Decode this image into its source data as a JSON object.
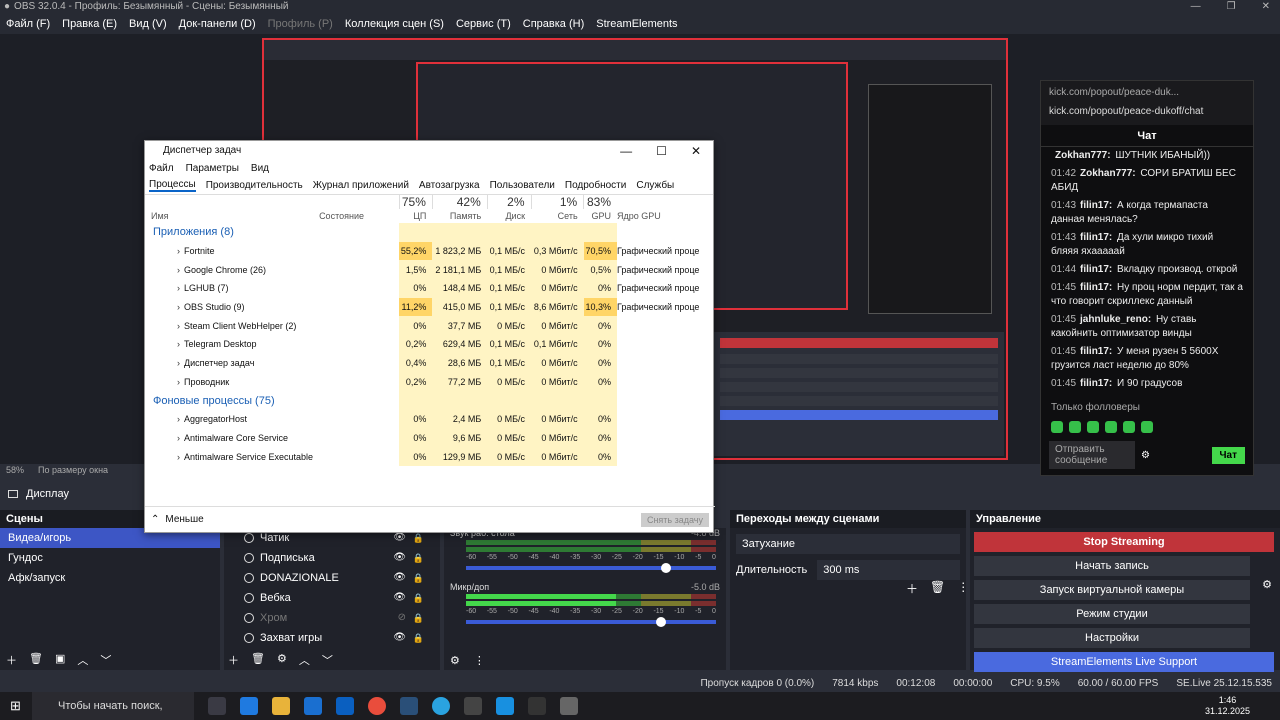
{
  "app": {
    "title": "OBS 32.0.4 - Профиль: Безымянный - Сцены: Безымянный",
    "menu": [
      "Файл (F)",
      "Правка (E)",
      "Вид (V)",
      "Док-панели (D)",
      "Профиль (P)",
      "Коллекция сцен (S)",
      "Сервис (T)",
      "Справка (H)",
      "StreamElements"
    ]
  },
  "preview": {
    "zoom": "58%",
    "fit": "По размеру окна"
  },
  "kick": {
    "url_short": "kick.com/popout/peace-duk...",
    "url": "kick.com/popout/peace-dukoff/chat",
    "header": "Чат",
    "messages": [
      {
        "time": "",
        "user": "Zokhan777:",
        "text": "ШУТНИК ИБАНЫЙ))"
      },
      {
        "time": "01:42",
        "user": "Zokhan777:",
        "text": "СОРИ БРАТИШ БЕС АБИД"
      },
      {
        "time": "01:43",
        "user": "filin17:",
        "text": "А когда термапаста данная менялась?"
      },
      {
        "time": "01:43",
        "user": "filin17:",
        "text": "Да хули микро тихий бляяя яхааааай"
      },
      {
        "time": "01:44",
        "user": "filin17:",
        "text": "Вкладку производ. открой"
      },
      {
        "time": "01:45",
        "user": "filin17:",
        "text": "Ну проц норм пердит, так а что говорит скриллекс данный"
      },
      {
        "time": "01:45",
        "user": "jahnluke_reno:",
        "text": "Ну ставь какойнить оптимизатор винды"
      },
      {
        "time": "01:45",
        "user": "filin17:",
        "text": "У меня рузен 5 5600X грузится ласт неделю до 80%"
      },
      {
        "time": "01:45",
        "user": "filin17:",
        "text": "И 90 градусов"
      }
    ],
    "followers": "Только фолловеры",
    "send_placeholder": "Отправить сообщение",
    "chat_button": "Чат"
  },
  "source_bar": {
    "selected": "Дисплау"
  },
  "scenes": {
    "title": "Сцены",
    "items": [
      "Видеа/игорь",
      "Гундос",
      "Афк/запуск"
    ]
  },
  "sources": {
    "items": [
      "Чатик",
      "Подписька",
      "DONAZIONALE",
      "Вебка",
      "Хром",
      "Захват игры"
    ]
  },
  "mixer": {
    "tracks": [
      {
        "name": "Звук раб. стола",
        "db": "-4.8 dB",
        "level": 0.0,
        "volume": 0.8
      },
      {
        "name": "Микр/доп",
        "db": "-5.0 dB",
        "level": 0.6,
        "volume": 0.78
      }
    ],
    "ticks": [
      "-60",
      "-55",
      "-50",
      "-45",
      "-40",
      "-35",
      "-30",
      "-25",
      "-20",
      "-15",
      "-10",
      "-5",
      "0"
    ]
  },
  "transitions": {
    "title": "Переходы между сценами",
    "type": "Затухание",
    "duration_label": "Длительность",
    "duration": "300 ms"
  },
  "controls": {
    "title": "Управление",
    "stop": "Stop Streaming",
    "record": "Начать запись",
    "virtualcam": "Запуск виртуальной камеры",
    "studio": "Режим студии",
    "settings": "Настройки",
    "support": "StreamElements Live Support"
  },
  "status": {
    "dropped": "Пропуск кадров 0 (0.0%)",
    "kbps": "7814 kbps",
    "live_time": "00:12:08",
    "rec_time": "00:00:00",
    "cpu": "CPU: 9.5%",
    "fps": "60.00 / 60.00 FPS",
    "se": "SE.Live 25.12.15.535"
  },
  "taskbar": {
    "search": "Чтобы начать поиск, введите",
    "time": "1:46",
    "date": "31.12.2025"
  },
  "taskmgr": {
    "title": "Диспетчер задач",
    "menu": [
      "Файл",
      "Параметры",
      "Вид"
    ],
    "tabs": [
      "Процессы",
      "Производительность",
      "Журнал приложений",
      "Автозагрузка",
      "Пользователи",
      "Подробности",
      "Службы"
    ],
    "headers": {
      "name": "Имя",
      "status": "Состояние",
      "cpu": "ЦП",
      "mem": "Память",
      "disk": "Диск",
      "net": "Сеть",
      "gpu": "GPU",
      "gpu_engine": "Ядро GPU"
    },
    "totals": {
      "cpu": "75%",
      "mem": "42%",
      "disk": "2%",
      "net": "1%",
      "gpu": "83%"
    },
    "apps_group": "Приложения (8)",
    "bg_group": "Фоновые процессы (75)",
    "apps": [
      {
        "name": "Fortnite",
        "cpu": "55,2%",
        "mem": "1 823,2 МБ",
        "disk": "0,1 МБ/с",
        "net": "0,3 Мбит/с",
        "gpu": "70,5%",
        "eng": "Графический проце"
      },
      {
        "name": "Google Chrome (26)",
        "cpu": "1,5%",
        "mem": "2 181,1 МБ",
        "disk": "0,1 МБ/с",
        "net": "0 Мбит/с",
        "gpu": "0,5%",
        "eng": "Графический проце"
      },
      {
        "name": "LGHUB (7)",
        "cpu": "0%",
        "mem": "148,4 МБ",
        "disk": "0,1 МБ/с",
        "net": "0 Мбит/с",
        "gpu": "0%",
        "eng": "Графический проце"
      },
      {
        "name": "OBS Studio (9)",
        "cpu": "11,2%",
        "mem": "415,0 МБ",
        "disk": "0,1 МБ/с",
        "net": "8,6 Мбит/с",
        "gpu": "10,3%",
        "eng": "Графический проце"
      },
      {
        "name": "Steam Client WebHelper (2)",
        "cpu": "0%",
        "mem": "37,7 МБ",
        "disk": "0 МБ/с",
        "net": "0 Мбит/с",
        "gpu": "0%",
        "eng": ""
      },
      {
        "name": "Telegram Desktop",
        "cpu": "0,2%",
        "mem": "629,4 МБ",
        "disk": "0,1 МБ/с",
        "net": "0,1 Мбит/с",
        "gpu": "0%",
        "eng": ""
      },
      {
        "name": "Диспетчер задач",
        "cpu": "0,4%",
        "mem": "28,6 МБ",
        "disk": "0,1 МБ/с",
        "net": "0 Мбит/с",
        "gpu": "0%",
        "eng": ""
      },
      {
        "name": "Проводник",
        "cpu": "0,2%",
        "mem": "77,2 МБ",
        "disk": "0 МБ/с",
        "net": "0 Мбит/с",
        "gpu": "0%",
        "eng": ""
      }
    ],
    "bg": [
      {
        "name": "AggregatorHost",
        "cpu": "0%",
        "mem": "2,4 МБ",
        "disk": "0 МБ/с",
        "net": "0 Мбит/с",
        "gpu": "0%",
        "eng": ""
      },
      {
        "name": "Antimalware Core Service",
        "cpu": "0%",
        "mem": "9,6 МБ",
        "disk": "0 МБ/с",
        "net": "0 Мбит/с",
        "gpu": "0%",
        "eng": ""
      },
      {
        "name": "Antimalware Service Executable",
        "cpu": "0%",
        "mem": "129,9 МБ",
        "disk": "0 МБ/с",
        "net": "0 Мбит/с",
        "gpu": "0%",
        "eng": ""
      }
    ],
    "less": "Меньше",
    "end_task": "Снять задачу"
  }
}
